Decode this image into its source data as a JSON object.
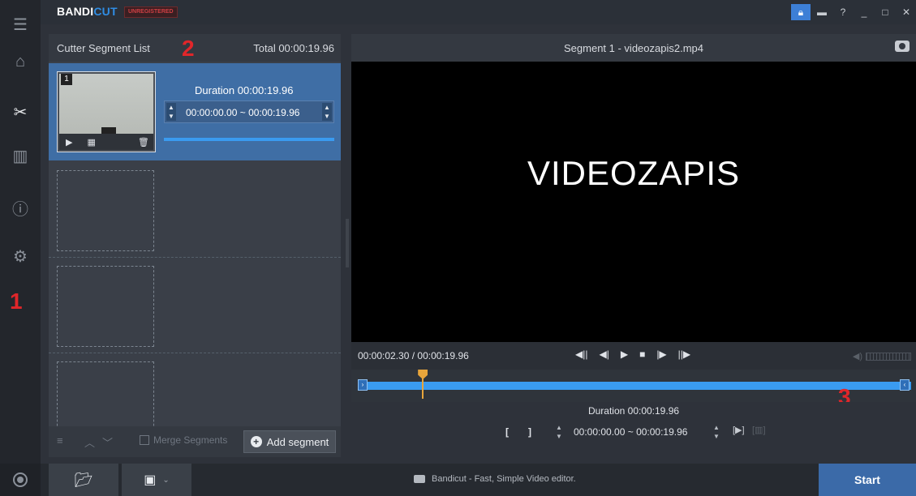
{
  "app": {
    "logo_main": "BANDI",
    "logo_accent": "CUT",
    "unregistered_badge": "UNREGISTERED"
  },
  "rail": {
    "annotation": "1"
  },
  "window_controls": [
    "lock-icon",
    "folder-icon",
    "help-icon",
    "minimize-icon",
    "maximize-icon",
    "close-icon"
  ],
  "segment_list": {
    "title": "Cutter Segment List",
    "annotation": "2",
    "total": "Total 00:00:19.96",
    "segments": [
      {
        "number": "1",
        "duration": "Duration 00:00:19.96",
        "range": "00:00:00.00 ~ 00:00:19.96"
      }
    ],
    "merge_label": "Merge Segments",
    "add_segment_label": "Add segment"
  },
  "player": {
    "title": "Segment 1 - videozapis2.mp4",
    "video_text": "VIDEOZAPIS",
    "time_position": "00:00:02.30 / 00:00:19.96",
    "playhead_fraction": 0.115,
    "annotation": "3",
    "duration": "Duration 00:00:19.96",
    "range": "00:00:00.00 ~ 00:00:19.96"
  },
  "bottom": {
    "status": "Bandicut - Fast, Simple Video editor.",
    "start_label": "Start"
  },
  "colors": {
    "accent": "#3a9bf0",
    "selected_segment": "#3f6ea5",
    "start_button": "#3b6aa8",
    "annotation": "#e0262a",
    "playhead": "#e8a53b"
  }
}
